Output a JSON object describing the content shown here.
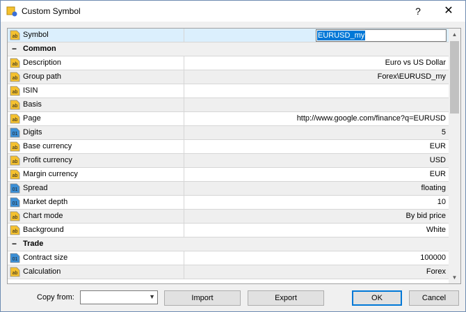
{
  "window": {
    "title": "Custom Symbol",
    "help_label": "?",
    "close_label": "✕"
  },
  "grid": {
    "rows": [
      {
        "kind": "prop",
        "icon": "ab",
        "name": "Symbol",
        "value": "EURUSD_my",
        "editing": true
      },
      {
        "kind": "group",
        "toggle": "−",
        "name": "Common"
      },
      {
        "kind": "prop",
        "icon": "ab",
        "name": "Description",
        "value": "Euro vs US Dollar"
      },
      {
        "kind": "prop",
        "icon": "ab",
        "name": "Group path",
        "value": "Forex\\EURUSD_my"
      },
      {
        "kind": "prop",
        "icon": "ab",
        "name": "ISIN",
        "value": ""
      },
      {
        "kind": "prop",
        "icon": "ab",
        "name": "Basis",
        "value": ""
      },
      {
        "kind": "prop",
        "icon": "ab",
        "name": "Page",
        "value": "http://www.google.com/finance?q=EURUSD"
      },
      {
        "kind": "prop",
        "icon": "01",
        "name": "Digits",
        "value": "5"
      },
      {
        "kind": "prop",
        "icon": "ab",
        "name": "Base currency",
        "value": "EUR"
      },
      {
        "kind": "prop",
        "icon": "ab",
        "name": "Profit currency",
        "value": "USD"
      },
      {
        "kind": "prop",
        "icon": "ab",
        "name": "Margin currency",
        "value": "EUR"
      },
      {
        "kind": "prop",
        "icon": "01",
        "name": "Spread",
        "value": "floating"
      },
      {
        "kind": "prop",
        "icon": "01",
        "name": "Market depth",
        "value": "10"
      },
      {
        "kind": "prop",
        "icon": "ab",
        "name": "Chart mode",
        "value": "By bid price"
      },
      {
        "kind": "prop",
        "icon": "ab",
        "name": "Background",
        "value": "White"
      },
      {
        "kind": "group",
        "toggle": "−",
        "name": "Trade"
      },
      {
        "kind": "prop",
        "icon": "01",
        "name": "Contract size",
        "value": "100000"
      },
      {
        "kind": "prop",
        "icon": "ab",
        "name": "Calculation",
        "value": "Forex"
      }
    ]
  },
  "footer": {
    "copy_from_label": "Copy from:",
    "copy_from_value": "",
    "import_label": "Import",
    "export_label": "Export",
    "ok_label": "OK",
    "cancel_label": "Cancel"
  },
  "colors": {
    "accent": "#0078d7",
    "selected_row": "#dbeffd",
    "alt_row": "#efefef",
    "icon_ab": "#f5c12e",
    "icon_01": "#3b8fd6"
  }
}
